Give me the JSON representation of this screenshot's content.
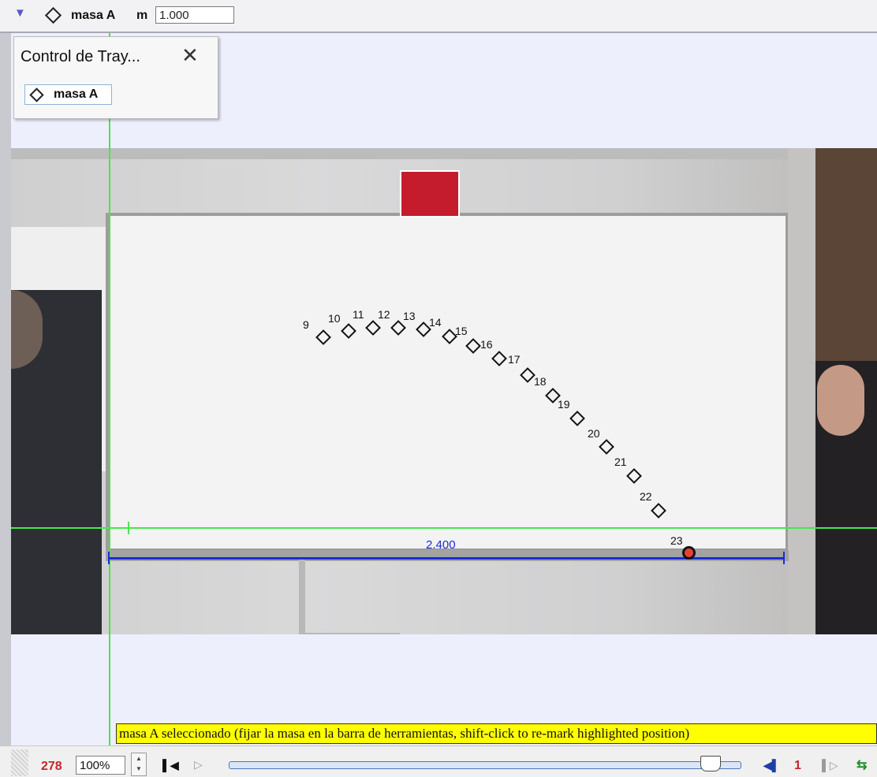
{
  "toolbar": {
    "track_name": "masa A",
    "mass_label": "m",
    "mass_value": "1.000"
  },
  "track_control": {
    "title": "Control de Tray...",
    "track_button": "masa A"
  },
  "tape": {
    "length_label": "2.400"
  },
  "trajectory": {
    "step_labels": [
      "9",
      "10",
      "11",
      "12",
      "13",
      "14",
      "15",
      "16",
      "17",
      "18",
      "19",
      "20",
      "21",
      "22",
      "23"
    ],
    "selected_step": "23"
  },
  "status": {
    "message": "masa A seleccionado (fijar la masa en la barra de herramientas, shift-click to re-mark highlighted position)"
  },
  "player": {
    "frame_number": "278",
    "zoom": "100%",
    "step_size": "1",
    "slider_fraction": 0.93
  },
  "colors": {
    "axis": "#45e84a",
    "tape": "#1c2bd8",
    "status_bg": "#ffff00",
    "frame_number": "#c8232c"
  }
}
